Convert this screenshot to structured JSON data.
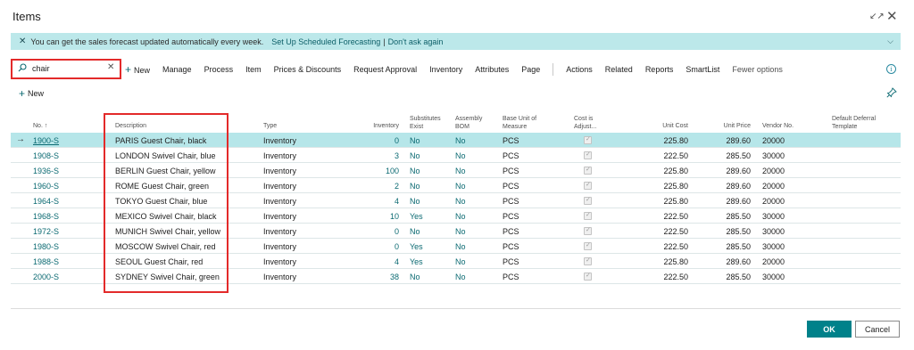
{
  "window": {
    "title": "Items",
    "collapse_icon": "collapse-icon",
    "close_icon": "close-icon"
  },
  "banner": {
    "message": "You can get the sales forecast updated automatically every week.",
    "link_setup": "Set Up Scheduled Forecasting",
    "separator": "|",
    "link_dismiss": "Don't ask again",
    "background": "#bce8ea"
  },
  "search": {
    "value": "chair",
    "icon": "search-icon",
    "clear_icon": "close-icon"
  },
  "actions": {
    "new": "New",
    "manage": "Manage",
    "process": "Process",
    "item": "Item",
    "prices_discounts": "Prices & Discounts",
    "request_approval": "Request Approval",
    "inventory": "Inventory",
    "attributes": "Attributes",
    "page": "Page",
    "actions": "Actions",
    "related": "Related",
    "reports": "Reports",
    "smartlist": "SmartList",
    "fewer_options": "Fewer options"
  },
  "list_new": "New",
  "columns": {
    "no": "No. ↑",
    "description": "Description",
    "type": "Type",
    "inventory": "Inventory",
    "substitutes_exist": "Substitutes Exist",
    "assembly_bom": "Assembly BOM",
    "base_unit": "Base Unit of Measure",
    "cost_adjusted": "Cost is Adjust...",
    "unit_cost": "Unit Cost",
    "unit_price": "Unit Price",
    "vendor_no": "Vendor No.",
    "deferral": "Default Deferral Template"
  },
  "rows": [
    {
      "no": "1900-S",
      "description": "PARIS Guest Chair, black",
      "type": "Inventory",
      "inventory": "0",
      "substitutes": "No",
      "bom": "No",
      "uom": "PCS",
      "unit_cost": "225.80",
      "unit_price": "289.60",
      "vendor": "20000"
    },
    {
      "no": "1908-S",
      "description": "LONDON Swivel Chair, blue",
      "type": "Inventory",
      "inventory": "3",
      "substitutes": "No",
      "bom": "No",
      "uom": "PCS",
      "unit_cost": "222.50",
      "unit_price": "285.50",
      "vendor": "30000"
    },
    {
      "no": "1936-S",
      "description": "BERLIN Guest Chair, yellow",
      "type": "Inventory",
      "inventory": "100",
      "substitutes": "No",
      "bom": "No",
      "uom": "PCS",
      "unit_cost": "225.80",
      "unit_price": "289.60",
      "vendor": "20000"
    },
    {
      "no": "1960-S",
      "description": "ROME Guest Chair, green",
      "type": "Inventory",
      "inventory": "2",
      "substitutes": "No",
      "bom": "No",
      "uom": "PCS",
      "unit_cost": "225.80",
      "unit_price": "289.60",
      "vendor": "20000"
    },
    {
      "no": "1964-S",
      "description": "TOKYO Guest Chair, blue",
      "type": "Inventory",
      "inventory": "4",
      "substitutes": "No",
      "bom": "No",
      "uom": "PCS",
      "unit_cost": "225.80",
      "unit_price": "289.60",
      "vendor": "20000"
    },
    {
      "no": "1968-S",
      "description": "MEXICO Swivel Chair, black",
      "type": "Inventory",
      "inventory": "10",
      "substitutes": "Yes",
      "bom": "No",
      "uom": "PCS",
      "unit_cost": "222.50",
      "unit_price": "285.50",
      "vendor": "30000"
    },
    {
      "no": "1972-S",
      "description": "MUNICH Swivel Chair, yellow",
      "type": "Inventory",
      "inventory": "0",
      "substitutes": "No",
      "bom": "No",
      "uom": "PCS",
      "unit_cost": "222.50",
      "unit_price": "285.50",
      "vendor": "30000"
    },
    {
      "no": "1980-S",
      "description": "MOSCOW Swivel Chair, red",
      "type": "Inventory",
      "inventory": "0",
      "substitutes": "Yes",
      "bom": "No",
      "uom": "PCS",
      "unit_cost": "222.50",
      "unit_price": "285.50",
      "vendor": "30000"
    },
    {
      "no": "1988-S",
      "description": "SEOUL Guest Chair, red",
      "type": "Inventory",
      "inventory": "4",
      "substitutes": "Yes",
      "bom": "No",
      "uom": "PCS",
      "unit_cost": "225.80",
      "unit_price": "289.60",
      "vendor": "20000"
    },
    {
      "no": "2000-S",
      "description": "SYDNEY Swivel Chair, green",
      "type": "Inventory",
      "inventory": "38",
      "substitutes": "No",
      "bom": "No",
      "uom": "PCS",
      "unit_cost": "222.50",
      "unit_price": "285.50",
      "vendor": "30000"
    }
  ],
  "footer": {
    "ok": "OK",
    "cancel": "Cancel",
    "accent": "#00818a"
  },
  "highlight_color": "#e32a2a"
}
